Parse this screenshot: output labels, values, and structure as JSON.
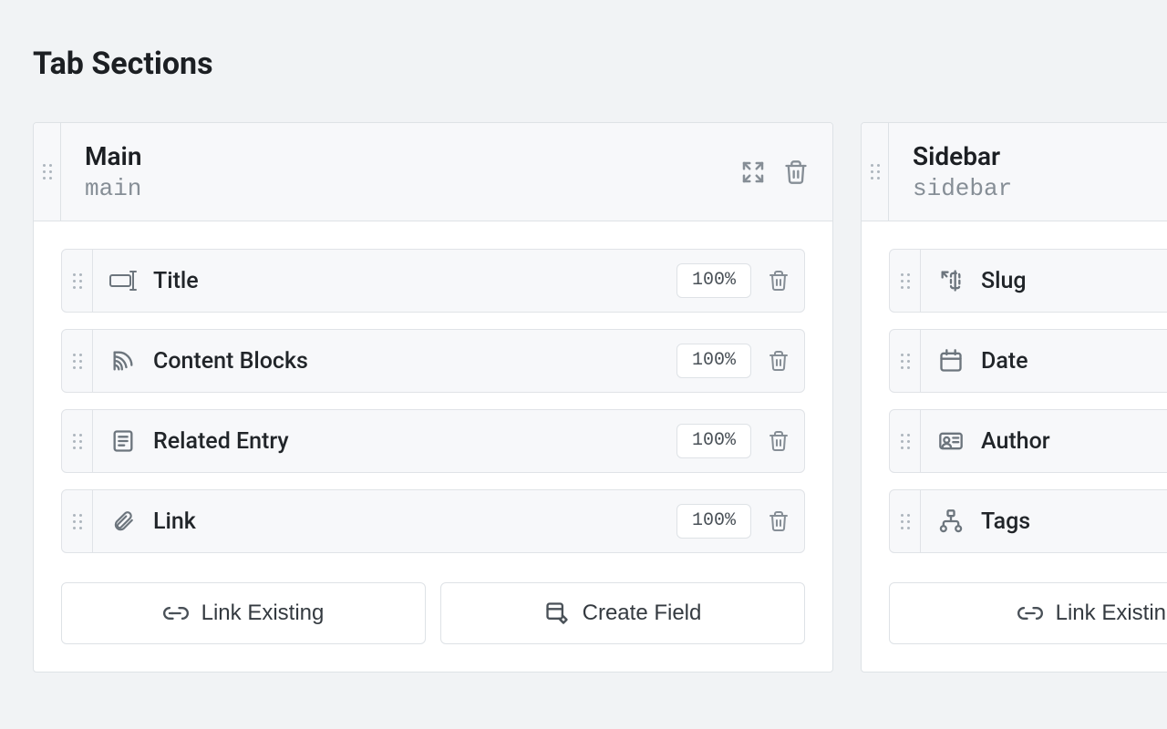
{
  "page_title": "Tab Sections",
  "sections": [
    {
      "title": "Main",
      "handle": "main",
      "fields": [
        {
          "label": "Title",
          "width": "100%",
          "icon": "text"
        },
        {
          "label": "Content Blocks",
          "width": "100%",
          "icon": "harp"
        },
        {
          "label": "Related Entry",
          "width": "100%",
          "icon": "document"
        },
        {
          "label": "Link",
          "width": "100%",
          "icon": "clip"
        }
      ],
      "actions": {
        "link_existing": "Link Existing",
        "create_field": "Create Field"
      }
    },
    {
      "title": "Sidebar",
      "handle": "sidebar",
      "fields": [
        {
          "label": "Slug",
          "icon": "slug"
        },
        {
          "label": "Date",
          "icon": "calendar"
        },
        {
          "label": "Author",
          "icon": "user-card"
        },
        {
          "label": "Tags",
          "icon": "structure"
        }
      ],
      "actions": {
        "link_existing": "Link Existing"
      }
    }
  ]
}
